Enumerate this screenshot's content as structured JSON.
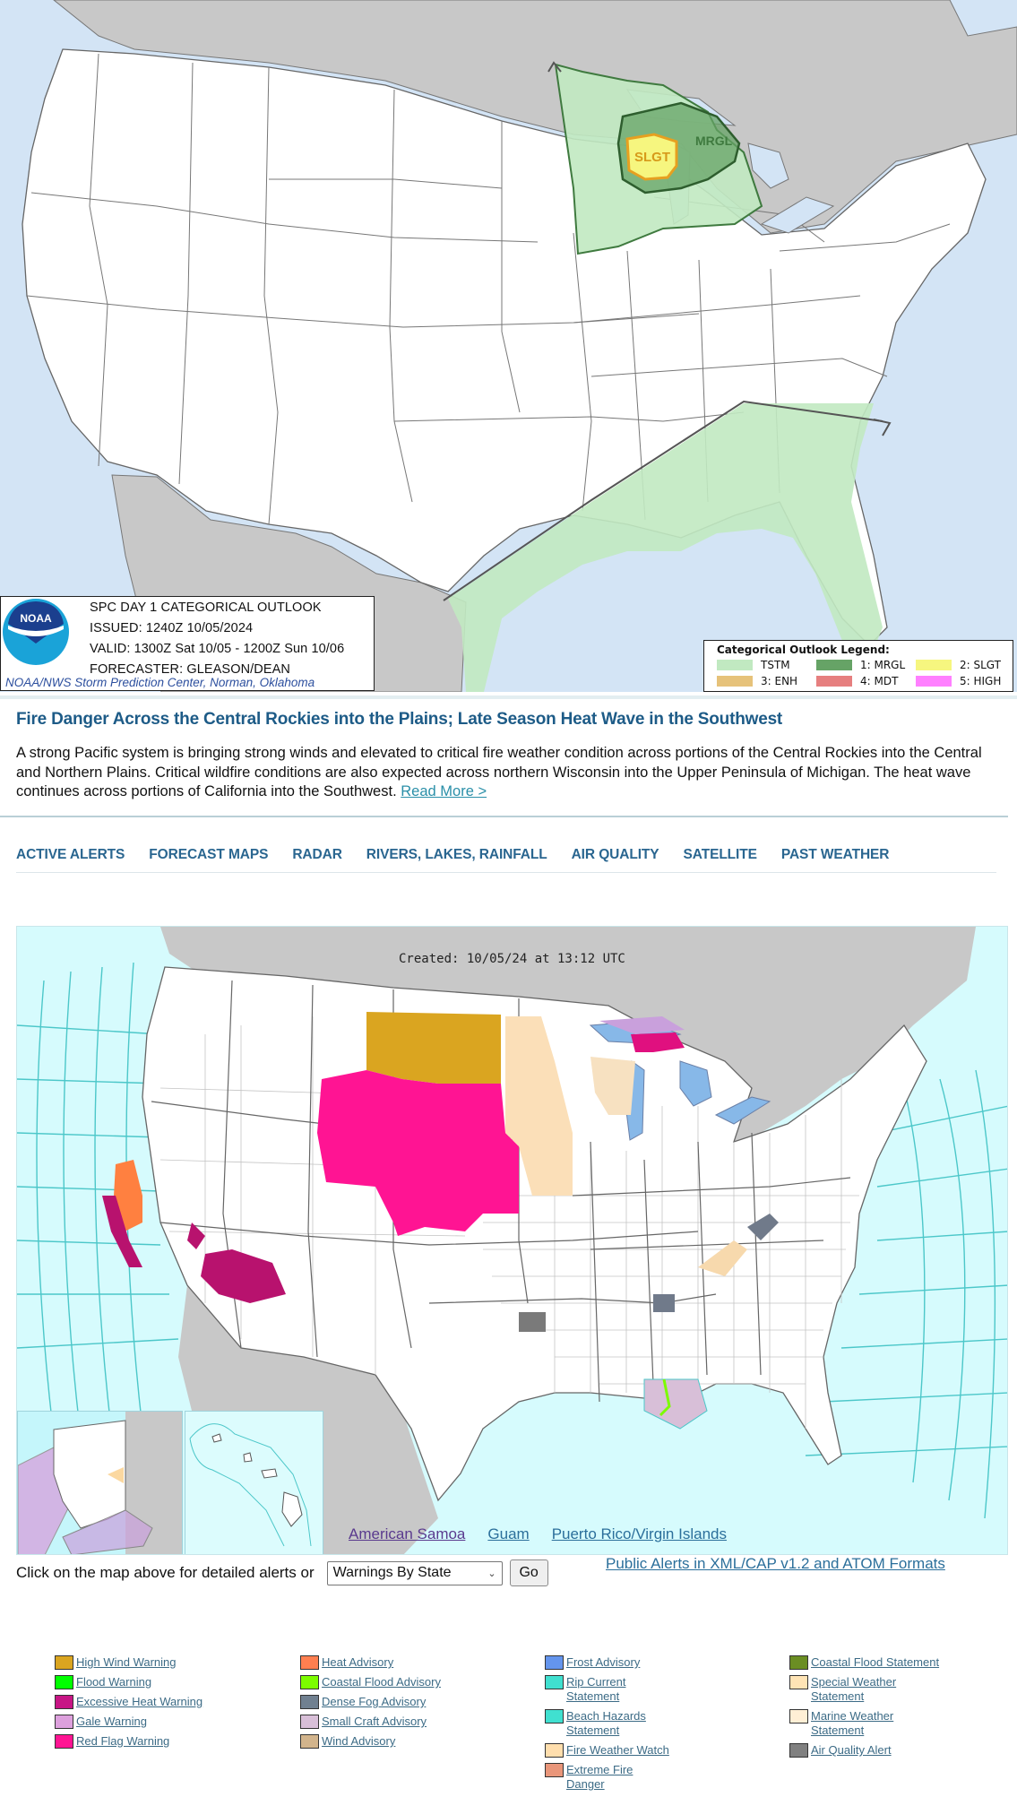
{
  "spc_outlook": {
    "title": "SPC DAY 1 CATEGORICAL OUTLOOK",
    "issued": "ISSUED: 1240Z 10/05/2024",
    "valid": "VALID: 1300Z Sat 10/05 - 1200Z Sun 10/06",
    "forecaster": "FORECASTER: GLEASON/DEAN",
    "credit": "NOAA/NWS Storm Prediction Center, Norman, Oklahoma",
    "logo_text": "NOAA",
    "map_labels": {
      "slight": "SLGT",
      "marginal": "MRGL"
    },
    "legend": {
      "title": "Categorical Outlook Legend:",
      "items": [
        {
          "label": "TSTM",
          "color": "#c1e9c1"
        },
        {
          "label": "1: MRGL",
          "color": "#66a366"
        },
        {
          "label": "2: SLGT",
          "color": "#f6f67f"
        },
        {
          "label": "3: ENH",
          "color": "#e6c27a"
        },
        {
          "label": "4: MDT",
          "color": "#e67f7f"
        },
        {
          "label": "5: HIGH",
          "color": "#ff80ff"
        }
      ]
    }
  },
  "headline": {
    "title": "Fire Danger Across the Central Rockies into the Plains; Late Season Heat Wave in the Southwest",
    "summary": "A strong Pacific system is bringing strong winds and elevated to critical fire weather condition across portions of the Central Rockies into the Central and Northern Plains. Critical wildfire conditions are also expected across northern Wisconsin into the Upper Peninsula of Michigan. The heat wave continues across portions of California into the Southwest.",
    "read_more": "Read More >"
  },
  "nav": {
    "items": [
      {
        "label": "ACTIVE ALERTS"
      },
      {
        "label": "FORECAST MAPS"
      },
      {
        "label": "RADAR"
      },
      {
        "label": "RIVERS, LAKES, RAINFALL"
      },
      {
        "label": "AIR QUALITY"
      },
      {
        "label": "SATELLITE"
      },
      {
        "label": "PAST WEATHER"
      }
    ]
  },
  "alerts_map": {
    "created": "Created: 10/05/24 at 13:12 UTC",
    "territories": [
      {
        "label": "American Samoa"
      },
      {
        "label": "Guam"
      },
      {
        "label": "Puerto Rico/Virgin Islands"
      }
    ]
  },
  "controls": {
    "label": "Click on the map above for detailed alerts or",
    "select_value": "Warnings By State",
    "go_label": "Go",
    "cap_link": "Public Alerts in XML/CAP v1.2 and ATOM Formats"
  },
  "alerts_legend": {
    "columns": [
      [
        {
          "label": "High Wind Warning",
          "color": "#daa520"
        },
        {
          "label": "Flood Warning",
          "color": "#00ff00"
        },
        {
          "label": "Excessive Heat Warning",
          "color": "#c71585"
        },
        {
          "label": "Gale Warning",
          "color": "#dda0dd"
        },
        {
          "label": "Red Flag Warning",
          "color": "#ff1493"
        }
      ],
      [
        {
          "label": "Heat Advisory",
          "color": "#ff7f50"
        },
        {
          "label": "Coastal Flood Advisory",
          "color": "#7cfc00"
        },
        {
          "label": "Dense Fog Advisory",
          "color": "#708090"
        },
        {
          "label": "Small Craft Advisory",
          "color": "#d8bfd8"
        },
        {
          "label": "Wind Advisory",
          "color": "#d2b48c"
        }
      ],
      [
        {
          "label": "Frost Advisory",
          "color": "#6495ed"
        },
        {
          "label": "Rip Current Statement",
          "color": "#40e0d0"
        },
        {
          "label": "Beach Hazards Statement",
          "color": "#40e0d0"
        },
        {
          "label": "Fire Weather Watch",
          "color": "#ffdead"
        },
        {
          "label": "Extreme Fire Danger",
          "color": "#e9967a"
        }
      ],
      [
        {
          "label": "Coastal Flood Statement",
          "color": "#6b8e23"
        },
        {
          "label": "Special Weather Statement",
          "color": "#ffe4b5"
        },
        {
          "label": "Marine Weather Statement",
          "color": "#ffefd5"
        },
        {
          "label": "Air Quality Alert",
          "color": "#808080"
        }
      ]
    ]
  }
}
